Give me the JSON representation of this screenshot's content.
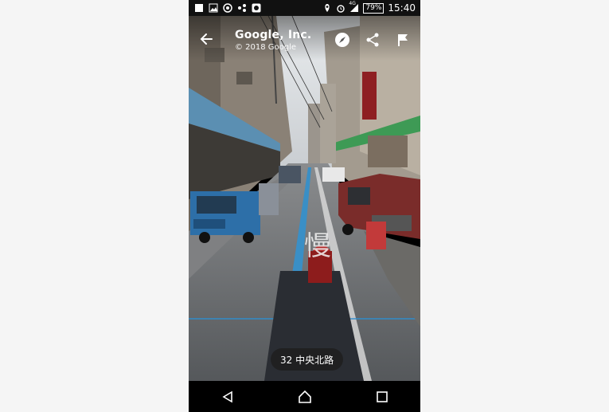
{
  "status_bar": {
    "icons_left": [
      "app-square-icon",
      "image-icon",
      "chrome-icon",
      "network-icon",
      "camera-app-icon"
    ],
    "network_label": "4G",
    "battery": "79%",
    "time": "15:40"
  },
  "viewer": {
    "title": "Google, Inc.",
    "copyright": "© 2018 Google",
    "address": "32 中央北路",
    "road_marking": "慢"
  },
  "colors": {
    "sky": "#d9dde0",
    "road": "#6d6f72",
    "accent_blue": "#2f8fd0"
  }
}
